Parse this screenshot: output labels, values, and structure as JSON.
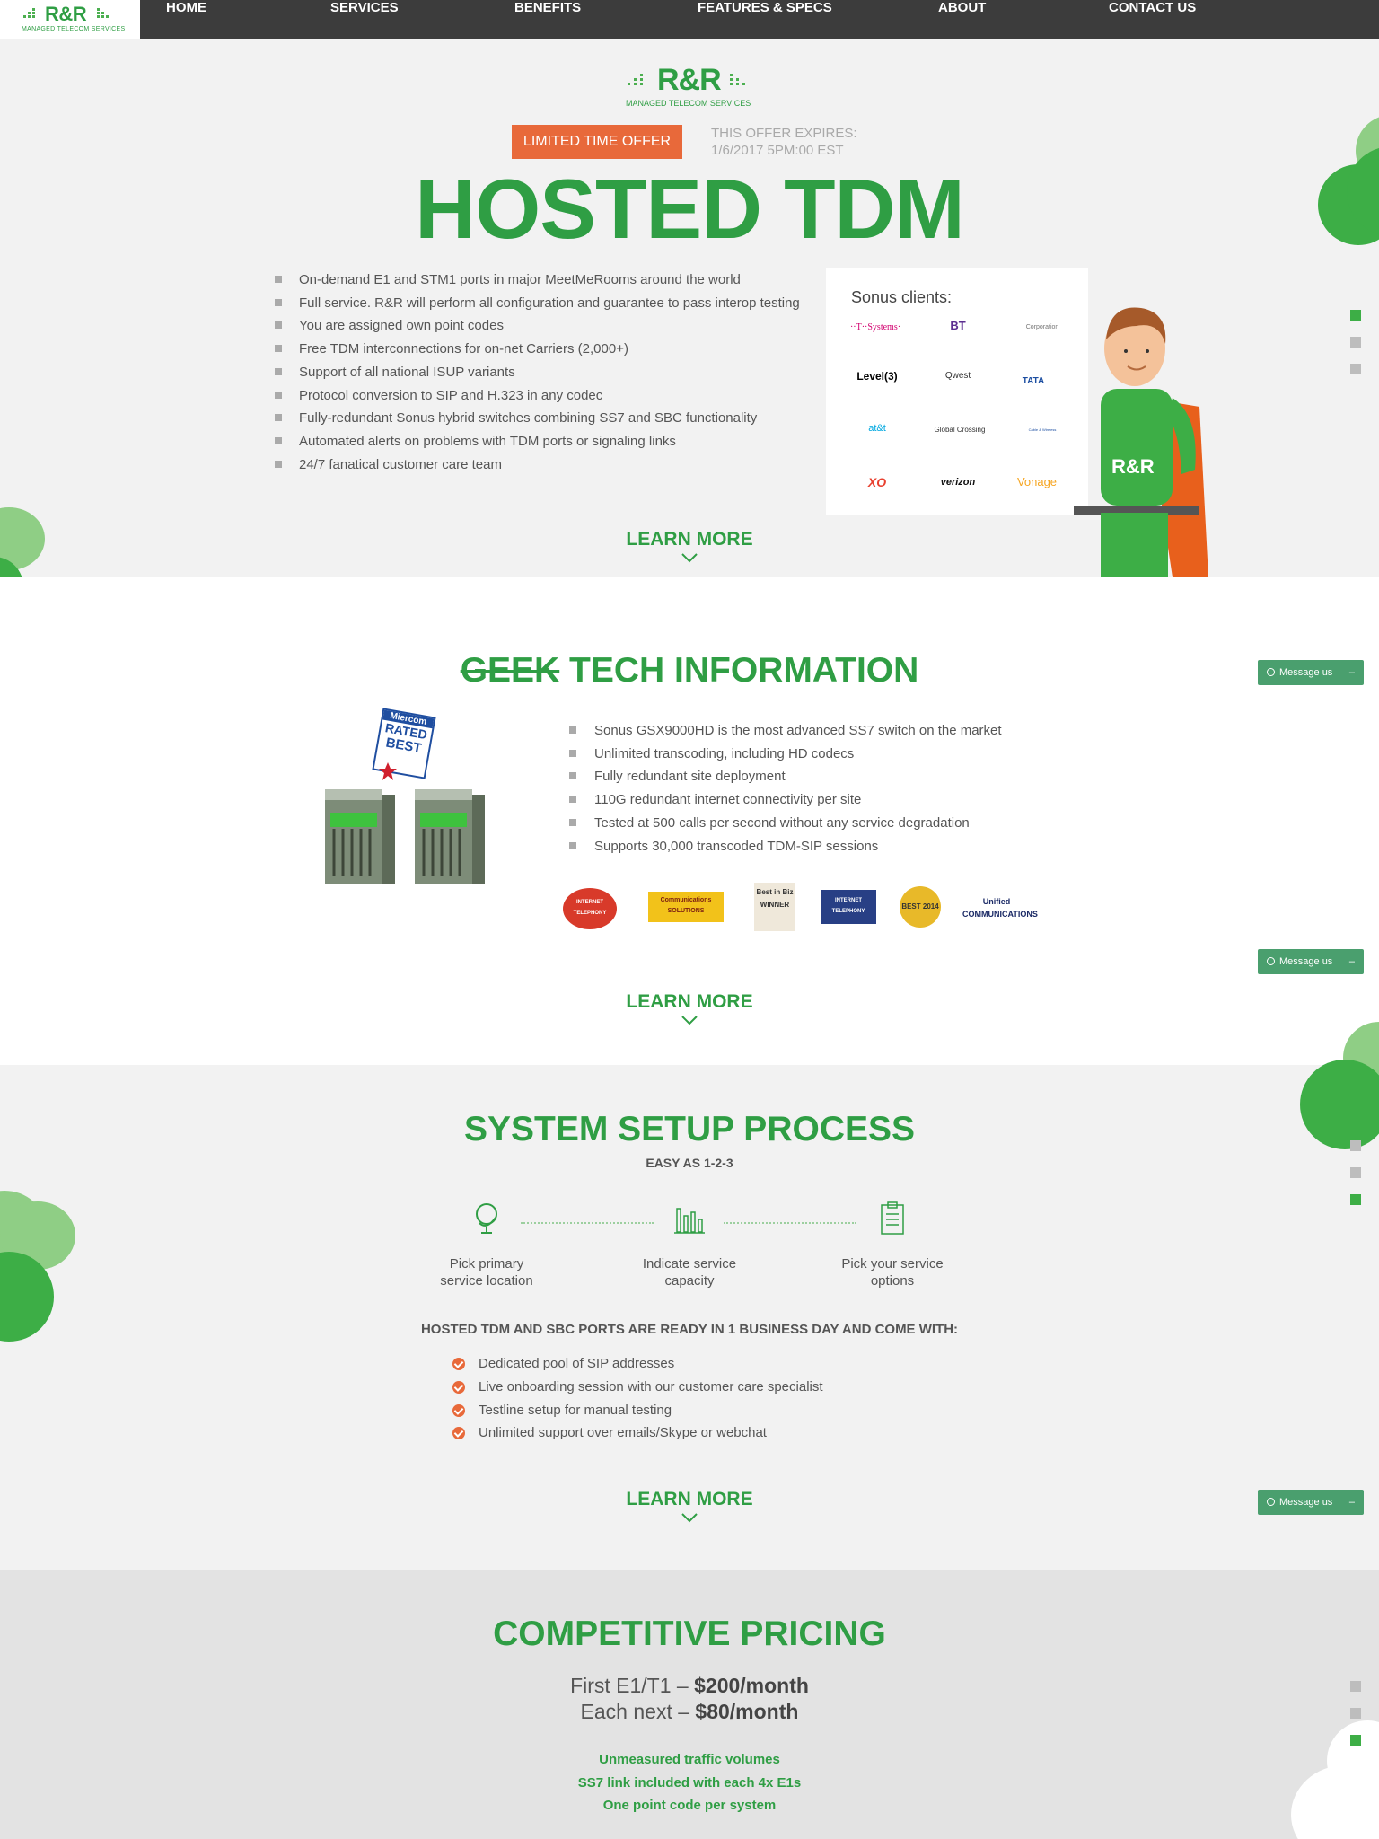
{
  "nav": {
    "logo_text": "R&R",
    "logo_subtitle": "MANAGED TELECOM SERVICES",
    "items": [
      "HOME",
      "SERVICES",
      "BENEFITS",
      "FEATURES & SPECS",
      "ABOUT",
      "CONTACT US"
    ]
  },
  "hero": {
    "logo_text": "R&R",
    "logo_subtitle": "MANAGED TELECOM SERVICES",
    "offer_label": "LIMITED TIME OFFER",
    "offer_expires_line1": "THIS OFFER EXPIRES:",
    "offer_expires_line2": "1/6/2017 5PM:00 EST",
    "title": "HOSTED TDM",
    "bullets": [
      "On-demand E1 and STM1 ports in major MeetMeRooms around the world",
      "Full service. R&R will perform all configuration and guarantee to pass interop testing",
      "You are assigned own point codes",
      "Free TDM interconnections for on-net Carriers (2,000+)",
      "Support of all national ISUP variants",
      "Protocol conversion to SIP and H.323 in any codec",
      "Fully-redundant Sonus hybrid switches combining SS7 and SBC functionality",
      "Automated alerts on problems with TDM ports or signaling links",
      "24/7 fanatical customer care team"
    ],
    "clients_title": "Sonus clients:",
    "clients": [
      "··T··Systems·",
      "BT",
      "Corporation",
      "Level(3)",
      "Qwest",
      "TATA",
      "at&t",
      "Global Crossing",
      "Cable & Wireless",
      "XO",
      "verizon",
      "Vonage"
    ],
    "mascot_shirt": "R&R",
    "learn_more": "LEARN MORE"
  },
  "tech": {
    "title_strike": "GEEK",
    "title_rest": " TECH INFORMATION",
    "rated_badge": [
      "Miercom",
      "RATED",
      "BEST"
    ],
    "bullets": [
      "Sonus GSX9000HD is the most advanced SS7 switch on the market",
      "Unlimited transcoding, including HD codecs",
      "Fully redundant site deployment",
      "110G redundant internet connectivity per site",
      "Tested at 500 calls per second without any service degradation",
      "Supports 30,000 transcoded TDM-SIP sessions"
    ],
    "awards": [
      "INTERNET TELEPHONY",
      "Communications SOLUTIONS",
      "Best in Biz WINNER",
      "INTERNET TELEPHONY",
      "BEST 2014",
      "Unified COMMUNICATIONS"
    ],
    "learn_more": "LEARN MORE"
  },
  "setup": {
    "title": "SYSTEM SETUP PROCESS",
    "subtitle": "EASY AS 1-2-3",
    "steps": [
      {
        "line1": "Pick primary",
        "line2": "service location",
        "icon": "globe-icon"
      },
      {
        "line1": "Indicate service",
        "line2": "capacity",
        "icon": "bar-chart-icon"
      },
      {
        "line1": "Pick your service",
        "line2": "options",
        "icon": "clipboard-icon"
      }
    ],
    "ready_heading": "HOSTED TDM AND SBC PORTS ARE READY IN 1 BUSINESS DAY AND COME WITH:",
    "checks": [
      "Dedicated pool of SIP addresses",
      "Live onboarding session with our customer care specialist",
      "Testline setup for manual testing",
      "Unlimited support over emails/Skype or webchat"
    ],
    "learn_more": "LEARN MORE"
  },
  "pricing": {
    "title": "COMPETITIVE PRICING",
    "line1_prefix": "First E1/T1 – ",
    "line1_price": "$200/month",
    "line2_prefix": "Each next – ",
    "line2_price": "$80/month",
    "features": [
      "Unmeasured traffic volumes",
      "SS7 link included with each 4x E1s",
      "One point code per system"
    ]
  },
  "message_widget": {
    "label": "Message us",
    "minimize": "–"
  },
  "colors": {
    "brand_green": "#2f9e44",
    "offer_orange": "#e8693a",
    "nav_bg": "#3c3c3c"
  }
}
